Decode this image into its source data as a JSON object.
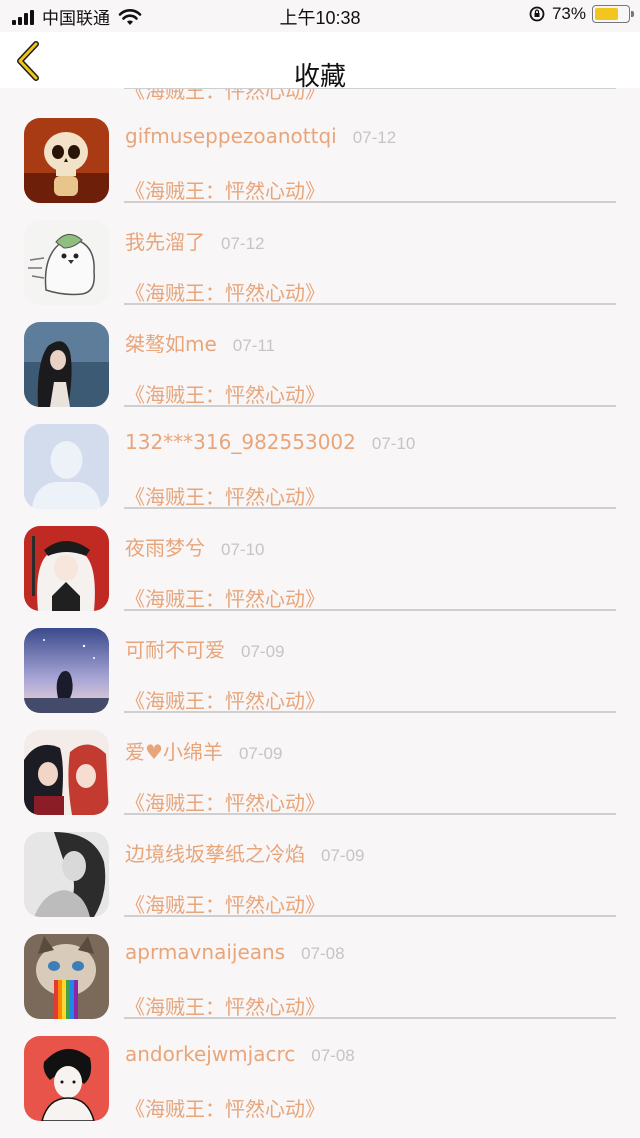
{
  "status_bar": {
    "carrier": "中国联通",
    "time": "上午10:38",
    "battery_percent": "73%",
    "battery_level": 0.73,
    "icons": [
      "signal-icon",
      "wifi-icon",
      "orientation-lock-icon",
      "battery-icon"
    ]
  },
  "navbar": {
    "title": "收藏",
    "back_icon": "chevron-left-icon",
    "accent_color": "#f0c418"
  },
  "colors": {
    "name": "#e8a57a",
    "date": "#c5c5c5",
    "divider": "#cfcfcf",
    "background": "#f8f6f7"
  },
  "items": [
    {
      "name": "",
      "date": "",
      "title": "《海贼王：怦然心动》",
      "avatar": "partial-avatar"
    },
    {
      "name": "gifmuseppezoanottqi",
      "date": "07-12",
      "title": "《海贼王：怦然心动》",
      "avatar": "skull-avatar"
    },
    {
      "name": "我先溜了",
      "date": "07-12",
      "title": "《海贼王：怦然心动》",
      "avatar": "penguin-ghost-avatar"
    },
    {
      "name": "桀骜如me",
      "date": "07-11",
      "title": "《海贼王：怦然心动》",
      "avatar": "girl-by-lake-avatar"
    },
    {
      "name": "132***316_982553002",
      "date": "07-10",
      "title": "《海贼王：怦然心动》",
      "avatar": "default-user-avatar"
    },
    {
      "name": "夜雨梦兮",
      "date": "07-10",
      "title": "《海贼王：怦然心动》",
      "avatar": "anime-girl-cap-avatar"
    },
    {
      "name": "可耐不可爱",
      "date": "07-09",
      "title": "《海贼王：怦然心动》",
      "avatar": "sky-silhouette-avatar"
    },
    {
      "name": "爱♥小绵羊",
      "date": "07-09",
      "title": "《海贼王：怦然心动》",
      "avatar": "anime-couple-avatar"
    },
    {
      "name": "边境线坂孳纸之冷焰",
      "date": "07-09",
      "title": "《海贼王：怦然心动》",
      "avatar": "monochrome-girl-avatar"
    },
    {
      "name": "aprmavnaijeans",
      "date": "07-08",
      "title": "《海贼王：怦然心动》",
      "avatar": "grumpy-cat-rainbow-avatar"
    },
    {
      "name": "andorkejwmjacrc",
      "date": "07-08",
      "title": "《海贼王：怦然心动》",
      "avatar": "manga-boy-avatar"
    }
  ]
}
